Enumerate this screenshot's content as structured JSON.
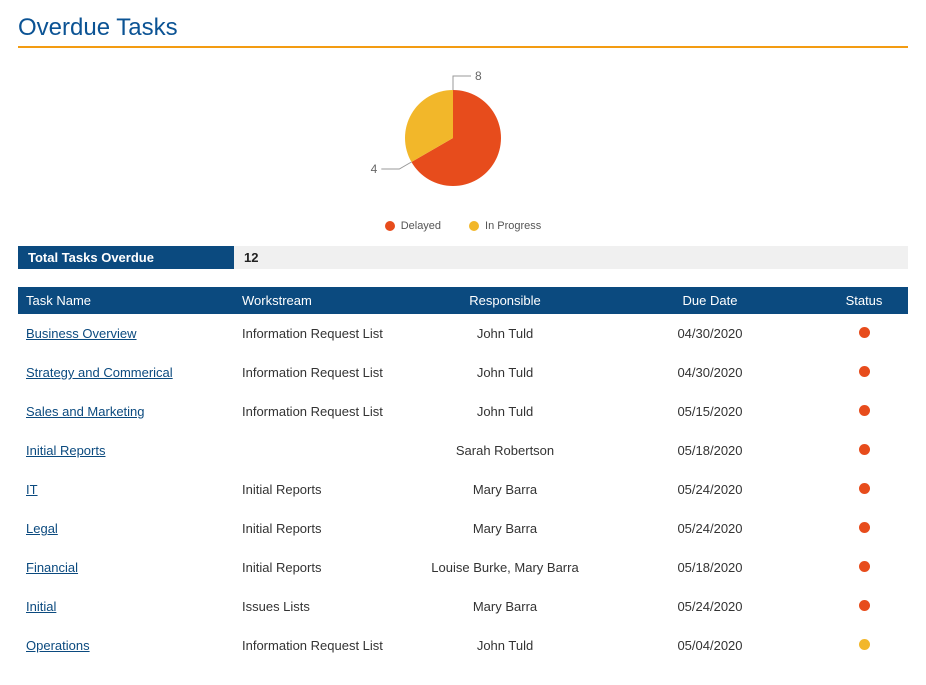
{
  "title": "Overdue Tasks",
  "colors": {
    "delayed": "#e74c1c",
    "in_progress": "#f2b72a",
    "header_bg": "#0b4a7f",
    "accent_rule": "#f39c12"
  },
  "chart_data": {
    "type": "pie",
    "title": "",
    "series": [
      {
        "name": "Delayed",
        "value": 8,
        "color": "#e74c1c"
      },
      {
        "name": "In Progress",
        "value": 4,
        "color": "#f2b72a"
      }
    ],
    "labels": [
      "8",
      "4"
    ],
    "legend_position": "bottom"
  },
  "summary": {
    "label": "Total Tasks Overdue",
    "value": "12"
  },
  "table": {
    "columns": [
      "Task Name",
      "Workstream",
      "Responsible",
      "Due Date",
      "Status"
    ],
    "rows": [
      {
        "name": "Business Overview",
        "workstream": "Information Request List",
        "responsible": "John Tuld",
        "due": "04/30/2020",
        "status": "delayed"
      },
      {
        "name": "Strategy and Commerical",
        "workstream": "Information Request List",
        "responsible": "John Tuld",
        "due": "04/30/2020",
        "status": "delayed"
      },
      {
        "name": "Sales and Marketing",
        "workstream": "Information Request List",
        "responsible": "John Tuld",
        "due": "05/15/2020",
        "status": "delayed"
      },
      {
        "name": "Initial Reports",
        "workstream": "",
        "responsible": "Sarah Robertson",
        "due": "05/18/2020",
        "status": "delayed"
      },
      {
        "name": "IT",
        "workstream": "Initial Reports",
        "responsible": "Mary Barra",
        "due": "05/24/2020",
        "status": "delayed"
      },
      {
        "name": "Legal",
        "workstream": "Initial Reports",
        "responsible": "Mary Barra",
        "due": "05/24/2020",
        "status": "delayed"
      },
      {
        "name": "Financial",
        "workstream": "Initial Reports",
        "responsible": "Louise Burke, Mary Barra",
        "due": "05/18/2020",
        "status": "delayed"
      },
      {
        "name": "Initial",
        "workstream": "Issues Lists",
        "responsible": "Mary Barra",
        "due": "05/24/2020",
        "status": "delayed"
      },
      {
        "name": "Operations",
        "workstream": "Information Request List",
        "responsible": "John Tuld",
        "due": "05/04/2020",
        "status": "in_progress"
      }
    ]
  },
  "legend": {
    "delayed": "Delayed",
    "in_progress": "In Progress"
  }
}
